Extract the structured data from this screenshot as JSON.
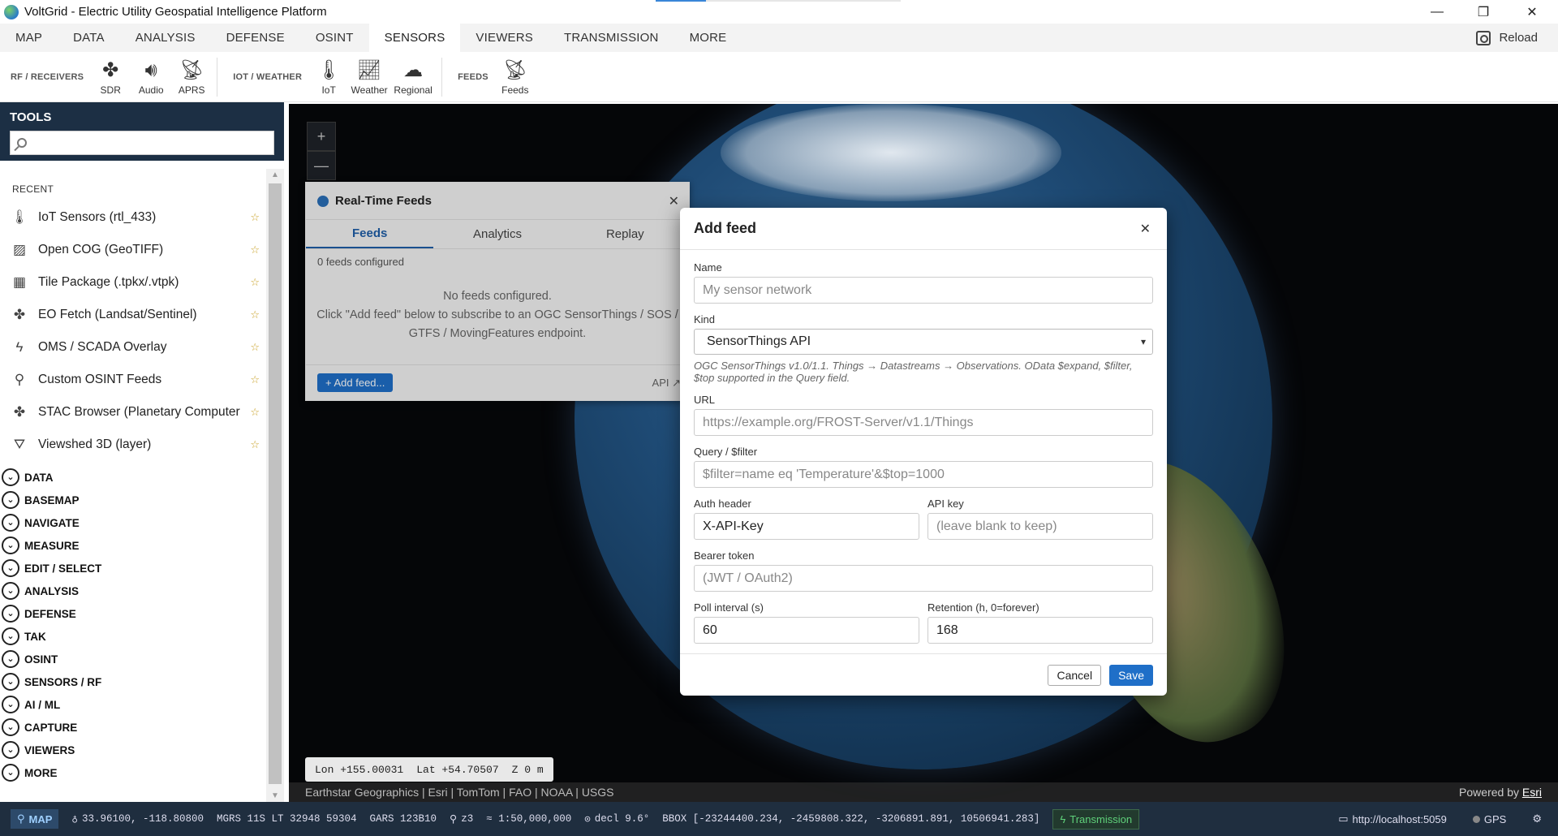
{
  "window": {
    "title": "VoltGrid - Electric Utility Geospatial Intelligence Platform",
    "minimize": "—",
    "maximize": "❐",
    "close": "✕"
  },
  "menu": {
    "items": [
      "MAP",
      "DATA",
      "ANALYSIS",
      "DEFENSE",
      "OSINT",
      "SENSORS",
      "VIEWERS",
      "TRANSMISSION",
      "MORE"
    ],
    "active": "SENSORS",
    "reload_label": "Reload"
  },
  "ribbon": {
    "groups": [
      {
        "label": "RF / RECEIVERS",
        "buttons": [
          {
            "label": "SDR",
            "icon": "satellite-icon"
          },
          {
            "label": "Audio",
            "icon": "speaker-icon"
          },
          {
            "label": "APRS",
            "icon": "antenna-icon"
          }
        ]
      },
      {
        "label": "IOT / WEATHER",
        "buttons": [
          {
            "label": "IoT",
            "icon": "thermometer-icon"
          },
          {
            "label": "Weather",
            "icon": "chart-icon"
          },
          {
            "label": "Regional",
            "icon": "cloud-icon"
          }
        ]
      },
      {
        "label": "FEEDS",
        "buttons": [
          {
            "label": "Feeds",
            "icon": "antenna-icon"
          }
        ]
      }
    ]
  },
  "tools": {
    "header": "TOOLS",
    "search_placeholder": "",
    "recent_label": "RECENT",
    "recent": [
      {
        "label": "IoT Sensors (rtl_433)",
        "icon": "thermometer-icon"
      },
      {
        "label": "Open COG (GeoTIFF)",
        "icon": "image-icon"
      },
      {
        "label": "Tile Package (.tpkx/.vtpk)",
        "icon": "map-package-icon"
      },
      {
        "label": "EO Fetch (Landsat/Sentinel)",
        "icon": "satellite-icon"
      },
      {
        "label": "OMS / SCADA Overlay",
        "icon": "lightning-icon"
      },
      {
        "label": "Custom OSINT Feeds",
        "icon": "search-icon"
      },
      {
        "label": "STAC Browser (Planetary Computer",
        "icon": "satellite-icon"
      },
      {
        "label": "Viewshed 3D (layer)",
        "icon": "viewshed-icon"
      }
    ],
    "sections": [
      "DATA",
      "BASEMAP",
      "NAVIGATE",
      "MEASURE",
      "EDIT / SELECT",
      "ANALYSIS",
      "DEFENSE",
      "TAK",
      "OSINT",
      "SENSORS / RF",
      "AI / ML",
      "CAPTURE",
      "VIEWERS",
      "MORE"
    ]
  },
  "map": {
    "zoom_in": "+",
    "zoom_out": "—",
    "lon": "Lon +155.00031",
    "lat": "Lat +54.70507",
    "z": "Z 0 m",
    "attribution": "Earthstar Geographics | Esri | TomTom | FAO | NOAA | USGS",
    "powered_prefix": "Powered by ",
    "powered_link": "Esri"
  },
  "feeds_panel": {
    "title": "Real-Time Feeds",
    "tabs": [
      "Feeds",
      "Analytics",
      "Replay"
    ],
    "count": "0 feeds configured",
    "empty_line1": "No feeds configured.",
    "empty_line2": "Click \"Add feed\" below to subscribe to an OGC SensorThings / SOS / GTFS / MovingFeatures endpoint.",
    "add_button": "+ Add feed...",
    "api_label": "API ↗"
  },
  "dialog": {
    "title": "Add feed",
    "name_label": "Name",
    "name_placeholder": "My sensor network",
    "kind_label": "Kind",
    "kind_value": "SensorThings API",
    "kind_hint": "OGC SensorThings v1.0/1.1. Things → Datastreams → Observations. OData $expand, $filter, $top supported in the Query field.",
    "url_label": "URL",
    "url_placeholder": "https://example.org/FROST-Server/v1.1/Things",
    "query_label": "Query / $filter",
    "query_placeholder": "$filter=name eq 'Temperature'&$top=1000",
    "auth_label": "Auth header",
    "auth_value": "X-API-Key",
    "apikey_label": "API key",
    "apikey_placeholder": "(leave blank to keep)",
    "bearer_label": "Bearer token",
    "bearer_placeholder": "(JWT / OAuth2)",
    "poll_label": "Poll interval (s)",
    "poll_value": "60",
    "retention_label": "Retention (h, 0=forever)",
    "retention_value": "168",
    "cancel": "Cancel",
    "save": "Save"
  },
  "status": {
    "map_label": "MAP",
    "coords": "33.96100, -118.80800",
    "mgrs": "MGRS 11S LT 32948 59304",
    "gars": "GARS 123B10",
    "zoom": "z3",
    "scale": "≈ 1:50,000,000",
    "decl": "decl 9.6°",
    "bbox": "BBOX [-23244400.234, -2459808.322, -3206891.891, 10506941.283]",
    "transmission": "Transmission",
    "server": "http://localhost:5059",
    "gps": "GPS"
  }
}
